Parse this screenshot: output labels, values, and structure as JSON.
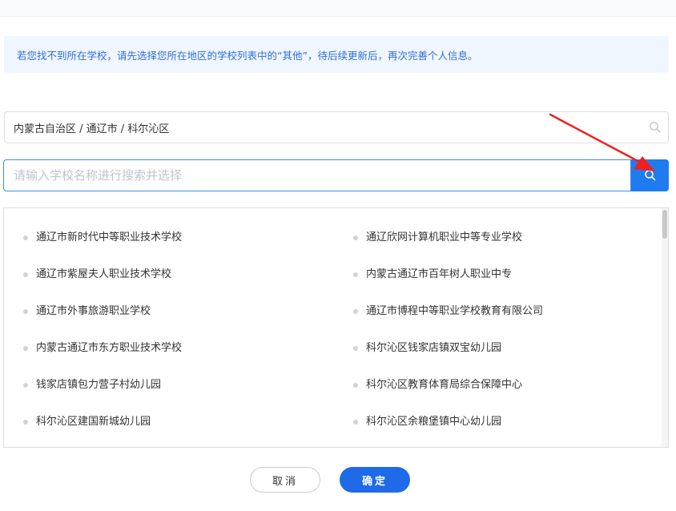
{
  "notice": {
    "text": "若您找不到所在学校，请先选择您所在地区的学校列表中的“其他”，待后续更新后，再次完善个人信息。"
  },
  "region": {
    "value": "内蒙古自治区 / 通辽市 / 科尔沁区",
    "icon": "search-icon"
  },
  "search": {
    "placeholder": "请输入学校名称进行搜索并选择",
    "value": "",
    "button_icon": "search-icon"
  },
  "schools": [
    "通辽市新时代中等职业技术学校",
    "通辽欣网计算机职业中等专业学校",
    "通辽市紫屋夫人职业技术学校",
    "内蒙古通辽市百年树人职业中专",
    "通辽市外事旅游职业学校",
    "通辽市博程中等职业学校教育有限公司",
    "内蒙古通辽市东方职业技术学校",
    "科尔沁区钱家店镇双宝幼儿园",
    "钱家店镇包力营子村幼儿园",
    "科尔沁区教育体育局综合保障中心",
    "科尔沁区建国新城幼儿园",
    "科尔沁区余粮堡镇中心幼儿园"
  ],
  "buttons": {
    "cancel": "取消",
    "confirm": "确定"
  },
  "colors": {
    "accent": "#1f7cf0",
    "confirm": "#1f6ae8",
    "notice_bg": "#f0f6ff",
    "notice_text": "#2f6fd6",
    "annotation_arrow": "#f02020"
  }
}
